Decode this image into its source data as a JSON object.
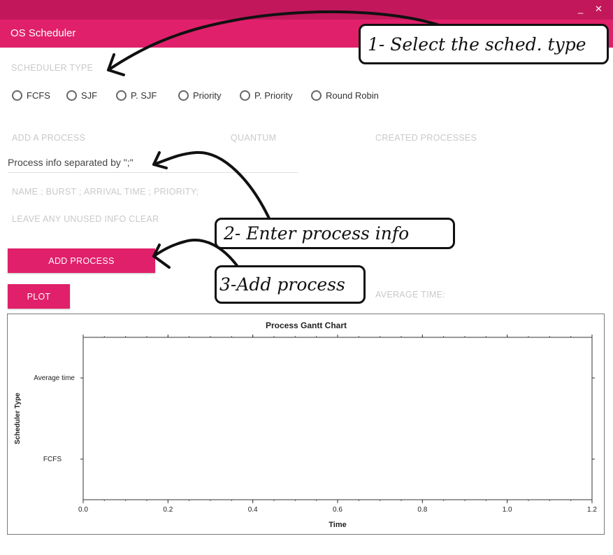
{
  "window": {
    "minimize": "_",
    "close": "✕"
  },
  "app": {
    "title": "OS Scheduler"
  },
  "scheduler": {
    "label": "SCHEDULER TYPE",
    "options": [
      "FCFS",
      "SJF",
      "P. SJF",
      "Priority",
      "P. Priority",
      "Round Robin"
    ]
  },
  "add_process": {
    "label": "ADD A PROCESS",
    "input_value": "Process info separated by \";\"",
    "hint1": "NAME ; BURST ; ARRIVAL TIME ; PRIORITY;",
    "hint2": "LEAVE ANY UNUSED INFO CLEAR",
    "button": "ADD PROCESS"
  },
  "quantum": {
    "label": "QUANTUM"
  },
  "created": {
    "label": "CREATED PROCESSES"
  },
  "plot": {
    "button": "PLOT"
  },
  "average": {
    "label": "AVERAGE TIME:"
  },
  "callouts": {
    "one": "1- Select the sched. type",
    "two": "2- Enter process info",
    "three": "3-Add process"
  },
  "colors": {
    "titlebar": "#c2185b",
    "accent": "#e0206a"
  },
  "chart_data": {
    "type": "bar",
    "title": "Process Gantt Chart",
    "xlabel": "Time",
    "ylabel": "Scheduler Type",
    "categories": [
      "Average time",
      "FCFS"
    ],
    "series": [],
    "xlim": [
      0,
      1.2
    ],
    "xticks": [
      "0.0",
      "0.2",
      "0.4",
      "0.6",
      "0.8",
      "1.0",
      "1.2"
    ],
    "grid": false
  }
}
